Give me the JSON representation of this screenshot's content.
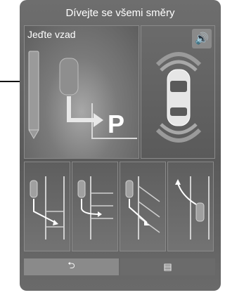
{
  "header": {
    "title": "Dívejte se všemi směry"
  },
  "left_panel": {
    "label": "Jeďte vzad",
    "parking_letter": "P"
  },
  "right_panel": {
    "sound_icon": "speaker-icon"
  },
  "tiles": [
    {
      "name": "perpendicular-parking"
    },
    {
      "name": "parallel-parking"
    },
    {
      "name": "angled-parking"
    },
    {
      "name": "exit-parking"
    }
  ],
  "nav": {
    "back_glyph": "⮌",
    "menu_glyph": "▤"
  }
}
